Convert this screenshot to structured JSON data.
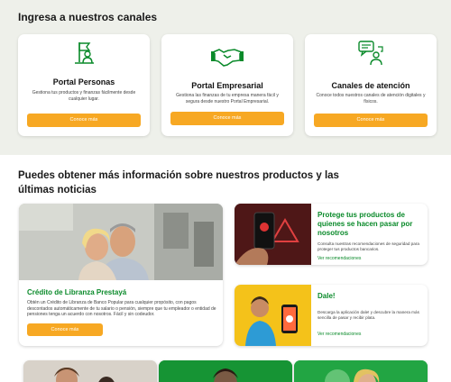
{
  "channels": {
    "title": "Ingresa a nuestros canales",
    "cards": [
      {
        "title": "Portal Personas",
        "description": "Gestiona tus productos y finanzas fácilmente desde cualquier lugar.",
        "button": "Conoce más",
        "icon": "flag-person-icon"
      },
      {
        "title": "Portal Empresarial",
        "description": "Gestiona las finanzas de tu empresa manera fácil y segura desde nuestro Portal Empresarial.",
        "button": "Conoce más",
        "icon": "handshake-icon"
      },
      {
        "title": "Canales de atención",
        "description": "Conoce todos nuestros canales de atención digitales y físicos.",
        "button": "Conoce más",
        "icon": "chat-support-icon"
      }
    ]
  },
  "news": {
    "title": "Puedes obtener más información sobre nuestros productos y las últimas noticias",
    "featured": {
      "title": "Crédito de Libranza Prestayá",
      "description": "Obtén un Crédito de Libranza de Banco Popular para cualquier propósito, con pagos descontados automáticamente de tu salario o pensión, siempre que tu empleador o entidad de pensiones tenga un acuerdo con nosotros. Fácil y sin codeudor.",
      "button": "Conoce más"
    },
    "items": [
      {
        "title": "Protege tus productos de quienes se hacen pasar por nosotros",
        "description": "Consulta nuestras recomendaciones de seguridad para proteger tus productos bancarios.",
        "link": "Ver recomendaciones"
      },
      {
        "title": "Dale!",
        "description": "Descarga la aplicación dale! y descubre la manera más sencilla de pasar y recibir plata.",
        "link": "Ver recomendaciones"
      }
    ]
  },
  "colors": {
    "accent": "#0a8a2a",
    "button": "#f7a823",
    "band": "#eef0ea"
  }
}
